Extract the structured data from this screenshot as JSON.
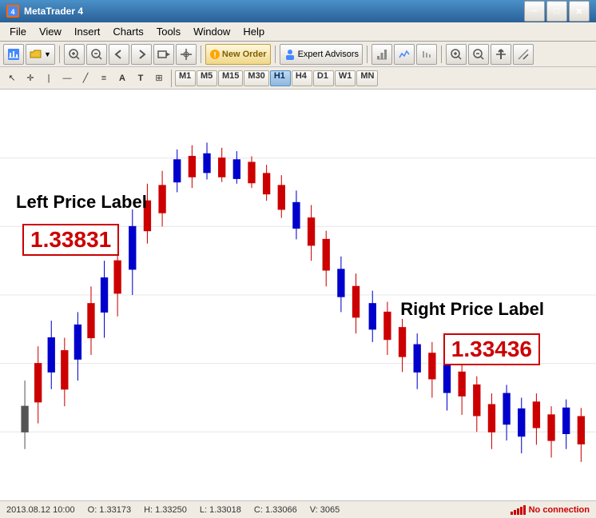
{
  "titleBar": {
    "title": "MetaTrader 4",
    "icon": "MT4",
    "controls": {
      "minimize": "─",
      "maximize": "□",
      "close": "✕"
    }
  },
  "menuBar": {
    "items": [
      "File",
      "View",
      "Insert",
      "Charts",
      "Tools",
      "Window",
      "Help"
    ]
  },
  "toolbar1": {
    "newOrder": "New Order",
    "expertAdvisors": "Expert Advisors"
  },
  "toolbar2": {
    "timeframes": [
      "M1",
      "M5",
      "M15",
      "M30",
      "H1",
      "H4",
      "D1",
      "W1",
      "MN"
    ],
    "activeTimeframe": "H1"
  },
  "chart": {
    "leftPriceLabel": "Left Price Label",
    "leftPriceValue": "1.33831",
    "rightPriceLabel": "Right Price Label",
    "rightPriceValue": "1.33436"
  },
  "statusBar": {
    "datetime": "2013.08.12 10:00",
    "open": "O: 1.33173",
    "high": "H: 1.33250",
    "low": "L: 1.33018",
    "close": "C: 1.33066",
    "volume": "V: 3065",
    "connection": "No connection"
  }
}
